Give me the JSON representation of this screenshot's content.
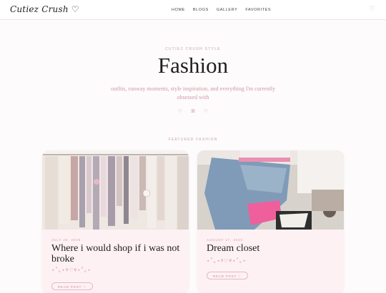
{
  "header": {
    "logo": "Cutiez Crush ♡",
    "nav": [
      "HOME",
      "BLOGS",
      "GALLERY",
      "FAVORITES"
    ],
    "heart_icon": "♡"
  },
  "hero": {
    "eyebrow": "CUTIEZ CRUSH STYLE",
    "title": "Fashion",
    "subtitle": "outfits, runway moments, style inspiration, and everything I'm currently obsessed with",
    "icons": [
      "♡",
      "ꕤ",
      "♡"
    ]
  },
  "featured": {
    "label": "FEATURED FASHION",
    "cards": [
      {
        "date": "JULY 20, 2025",
        "title": "Where i would shop if i was not broke",
        "sparkle": "⋆˚｡⋆୨♡୧⋆˚｡⋆",
        "button": "READ POST ♡"
      },
      {
        "date": "AUGUST 17, 2025",
        "title": "Dream closet",
        "sparkle": "⋆˚｡⋆୨♡୧⋆˚｡⋆",
        "button": "READ POST ♡"
      }
    ]
  },
  "colors": {
    "accent_pink": "#d497a7",
    "card_bg": "#fdf1f4",
    "page_bg": "#fdfbfb"
  }
}
